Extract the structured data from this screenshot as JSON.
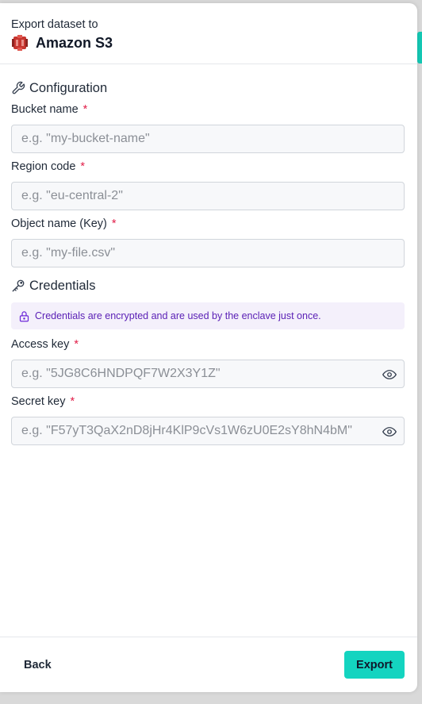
{
  "header": {
    "subtitle": "Export dataset to",
    "title": "Amazon S3",
    "icon": "amazon-s3-icon"
  },
  "sections": {
    "configuration": {
      "title": "Configuration",
      "icon": "wrench-icon"
    },
    "credentials": {
      "title": "Credentials",
      "icon": "key-icon"
    }
  },
  "fields": {
    "bucket_name": {
      "label": "Bucket name",
      "required_mark": "*",
      "placeholder": "e.g. \"my-bucket-name\"",
      "value": ""
    },
    "region_code": {
      "label": "Region code",
      "required_mark": "*",
      "placeholder": "e.g. \"eu-central-2\"",
      "value": ""
    },
    "object_name": {
      "label": "Object name (Key)",
      "required_mark": "*",
      "placeholder": "e.g. \"my-file.csv\"",
      "value": ""
    },
    "access_key": {
      "label": "Access key",
      "required_mark": "*",
      "placeholder": "e.g. \"5JG8C6HNDPQF7W2X3Y1Z\"",
      "value": ""
    },
    "secret_key": {
      "label": "Secret key",
      "required_mark": "*",
      "placeholder": "e.g. \"F57yT3QaX2nD8jHr4KlP9cVs1W6zU0E2sY8hN4bM\"",
      "value": ""
    }
  },
  "notice": {
    "text": "Credentials are encrypted and are used by the enclave just once.",
    "icon": "lock-icon"
  },
  "footer": {
    "back_label": "Back",
    "export_label": "Export"
  },
  "colors": {
    "accent": "#14d4c0",
    "required": "#e11d48",
    "notice_text": "#5b21b6",
    "notice_bg": "#f4f0fb",
    "s3_red": "#c7352f"
  }
}
